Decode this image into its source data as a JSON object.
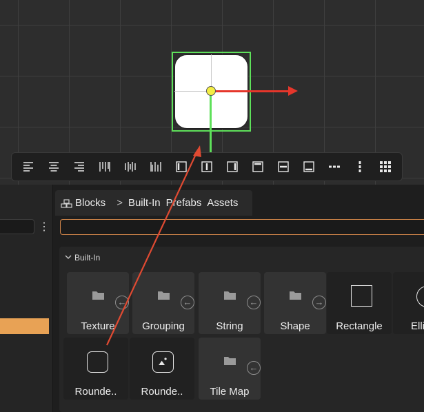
{
  "toolbar": {
    "buttons": [
      {
        "icon": "align-left-icon"
      },
      {
        "icon": "align-center-icon"
      },
      {
        "icon": "align-right-icon"
      },
      {
        "icon": "distribute-left-icon"
      },
      {
        "icon": "distribute-center-icon"
      },
      {
        "icon": "distribute-right-icon"
      },
      {
        "icon": "align-left-edge-icon"
      },
      {
        "icon": "align-h-center-icon"
      },
      {
        "icon": "align-right-edge-icon"
      },
      {
        "icon": "align-top-edge-icon"
      },
      {
        "icon": "align-v-center-icon"
      },
      {
        "icon": "align-bottom-edge-icon"
      },
      {
        "icon": "horizontal-dots-icon"
      },
      {
        "icon": "vertical-dots-icon"
      },
      {
        "icon": "grid-icon"
      }
    ]
  },
  "breadcrumb": {
    "root": "Blocks",
    "separator": ">",
    "items": [
      "Built-In",
      "Prefabs",
      "Assets"
    ]
  },
  "search": {
    "value": "",
    "placeholder": ""
  },
  "section": {
    "title": "Built-In"
  },
  "tiles": [
    {
      "label": "Texture",
      "icon": "folder-icon",
      "badge": "arrow-left-icon"
    },
    {
      "label": "Grouping",
      "icon": "folder-icon",
      "badge": "arrow-left-icon"
    },
    {
      "label": "String",
      "icon": "folder-icon",
      "badge": "arrow-left-icon"
    },
    {
      "label": "Shape",
      "icon": "folder-icon",
      "badge": "arrow-right-icon"
    },
    {
      "label": "Rectangle",
      "icon": "rectangle-icon"
    },
    {
      "label": "Elli",
      "icon": "ellipse-icon"
    },
    {
      "label": "Rounde..",
      "icon": "rounded-rect-icon"
    },
    {
      "label": "Rounde..",
      "icon": "rounded-image-icon"
    },
    {
      "label": "Tile Map",
      "icon": "folder-icon",
      "badge": "arrow-left-icon"
    }
  ],
  "colors": {
    "accent": "#e8a255",
    "search_border": "#d4874a",
    "selection": "#5ee05a",
    "x_axis": "#e5362b",
    "annotation_arrow": "#e04a32"
  }
}
